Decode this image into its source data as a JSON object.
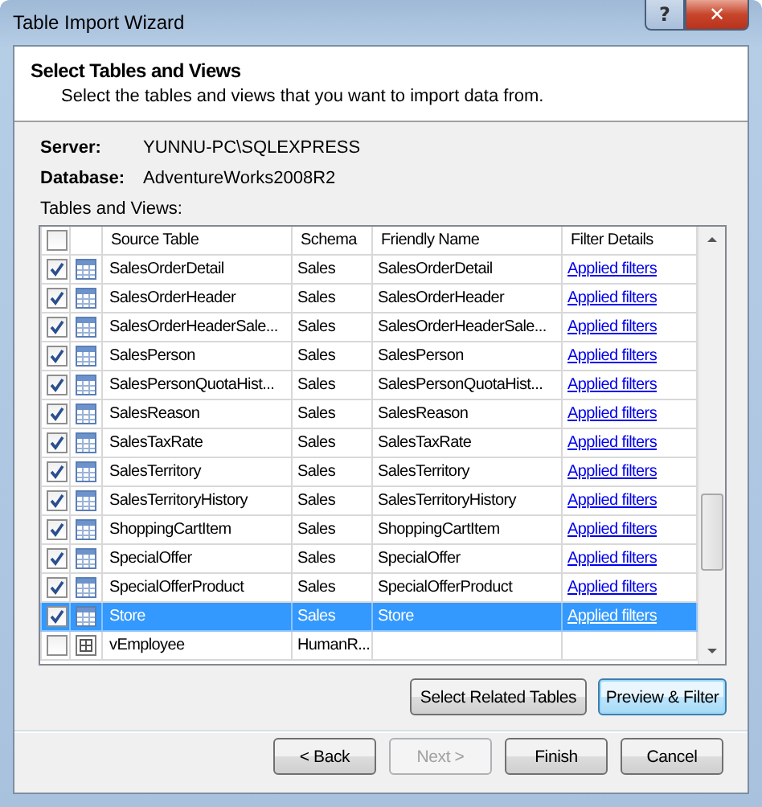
{
  "window": {
    "title": "Table Import Wizard",
    "help_button": "?",
    "close_button": "✕"
  },
  "header": {
    "title": "Select Tables and Views",
    "subtitle": "Select the tables and views that you want to import data from."
  },
  "connection": [
    {
      "label": "Server:",
      "value": "YUNNU-PC\\SQLEXPRESS"
    },
    {
      "label": "Database:",
      "value": "AdventureWorks2008R2"
    }
  ],
  "list_label": "Tables and Views:",
  "table": {
    "select_all": {
      "checked": false
    },
    "columns": [
      "Source Table",
      "Schema",
      "Friendly Name",
      "Filter Details"
    ],
    "rows": [
      {
        "kind": "table",
        "checked": true,
        "selected": false,
        "source": "SalesOrderDetail",
        "schema": "Sales",
        "friendly": "SalesOrderDetail",
        "filter": "Applied filters"
      },
      {
        "kind": "table",
        "checked": true,
        "selected": false,
        "source": "SalesOrderHeader",
        "schema": "Sales",
        "friendly": "SalesOrderHeader",
        "filter": "Applied filters"
      },
      {
        "kind": "table",
        "checked": true,
        "selected": false,
        "source": "SalesOrderHeaderSale...",
        "schema": "Sales",
        "friendly": "SalesOrderHeaderSale...",
        "filter": "Applied filters"
      },
      {
        "kind": "table",
        "checked": true,
        "selected": false,
        "source": "SalesPerson",
        "schema": "Sales",
        "friendly": "SalesPerson",
        "filter": "Applied filters"
      },
      {
        "kind": "table",
        "checked": true,
        "selected": false,
        "source": "SalesPersonQuotaHist...",
        "schema": "Sales",
        "friendly": "SalesPersonQuotaHist...",
        "filter": "Applied filters"
      },
      {
        "kind": "table",
        "checked": true,
        "selected": false,
        "source": "SalesReason",
        "schema": "Sales",
        "friendly": "SalesReason",
        "filter": "Applied filters"
      },
      {
        "kind": "table",
        "checked": true,
        "selected": false,
        "source": "SalesTaxRate",
        "schema": "Sales",
        "friendly": "SalesTaxRate",
        "filter": "Applied filters"
      },
      {
        "kind": "table",
        "checked": true,
        "selected": false,
        "source": "SalesTerritory",
        "schema": "Sales",
        "friendly": "SalesTerritory",
        "filter": "Applied filters"
      },
      {
        "kind": "table",
        "checked": true,
        "selected": false,
        "source": "SalesTerritoryHistory",
        "schema": "Sales",
        "friendly": "SalesTerritoryHistory",
        "filter": "Applied filters"
      },
      {
        "kind": "table",
        "checked": true,
        "selected": false,
        "source": "ShoppingCartItem",
        "schema": "Sales",
        "friendly": "ShoppingCartItem",
        "filter": "Applied filters"
      },
      {
        "kind": "table",
        "checked": true,
        "selected": false,
        "source": "SpecialOffer",
        "schema": "Sales",
        "friendly": "SpecialOffer",
        "filter": "Applied filters"
      },
      {
        "kind": "table",
        "checked": true,
        "selected": false,
        "source": "SpecialOfferProduct",
        "schema": "Sales",
        "friendly": "SpecialOfferProduct",
        "filter": "Applied filters"
      },
      {
        "kind": "table",
        "checked": true,
        "selected": true,
        "source": "Store",
        "schema": "Sales",
        "friendly": "Store",
        "filter": "Applied filters"
      },
      {
        "kind": "view",
        "checked": false,
        "selected": false,
        "source": "vEmployee",
        "schema": "HumanR..."
      }
    ]
  },
  "actions": [
    {
      "label": "Select Related Tables",
      "focused": false
    },
    {
      "label": "Preview & Filter",
      "focused": true
    }
  ],
  "nav_buttons": [
    {
      "label": "< Back",
      "disabled": false
    },
    {
      "label": "Next >",
      "disabled": true
    },
    {
      "label": "Finish",
      "disabled": false
    },
    {
      "label": "Cancel",
      "disabled": false
    }
  ]
}
